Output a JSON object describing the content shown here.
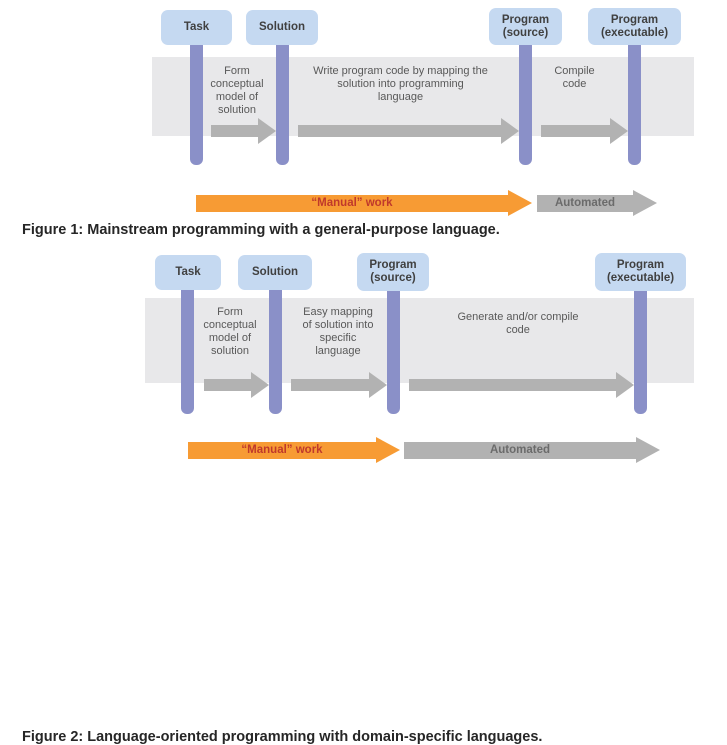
{
  "document": {
    "type": "two-panel process diagram",
    "background_color": "#ffffff"
  },
  "palette": {
    "node_fill": "#c5d9f1",
    "pillar": "#8a90c8",
    "band": "#e8e8ea",
    "grey_arrow": "#b2b2b2",
    "orange_arrow": "#f79b34",
    "manual_label_text": "#c0392b",
    "automated_label_text": "#6b6b6b",
    "phase_text": "#595959",
    "caption_text": "#262626"
  },
  "figure1": {
    "caption": "Figure 1: Mainstream programming with a general-purpose language.",
    "nodes": [
      {
        "id": "task",
        "label": "Task"
      },
      {
        "id": "solution",
        "label": "Solution"
      },
      {
        "id": "program-source",
        "label": "Program\n(source)"
      },
      {
        "id": "program-executable",
        "label": "Program\n(executable)"
      }
    ],
    "phases": [
      {
        "id": "form-conceptual-model",
        "text": "Form\nconceptual\nmodel of\nsolution"
      },
      {
        "id": "write-program-code",
        "text": "Write program code by mapping the\nsolution into programming\nlanguage"
      },
      {
        "id": "compile-code",
        "text": "Compile\ncode"
      }
    ],
    "summary_arrows": [
      {
        "id": "manual-work",
        "label": "“Manual” work",
        "color": "#f79b34"
      },
      {
        "id": "automated",
        "label": "Automated",
        "color": "#b2b2b2"
      }
    ]
  },
  "figure2": {
    "caption": "Figure 2: Language-oriented programming with domain-specific languages.",
    "nodes": [
      {
        "id": "task",
        "label": "Task"
      },
      {
        "id": "solution",
        "label": "Solution"
      },
      {
        "id": "program-source",
        "label": "Program\n(source)"
      },
      {
        "id": "program-executable",
        "label": "Program\n(executable)"
      }
    ],
    "phases": [
      {
        "id": "form-conceptual-model",
        "text": "Form\nconceptual\nmodel of\nsolution"
      },
      {
        "id": "easy-mapping",
        "text": "Easy mapping\nof solution into\nspecific\nlanguage"
      },
      {
        "id": "generate-compile-code",
        "text": "Generate and/or compile\ncode"
      }
    ],
    "summary_arrows": [
      {
        "id": "manual-work",
        "label": "“Manual” work",
        "color": "#f79b34"
      },
      {
        "id": "automated",
        "label": "Automated",
        "color": "#b2b2b2"
      }
    ]
  }
}
